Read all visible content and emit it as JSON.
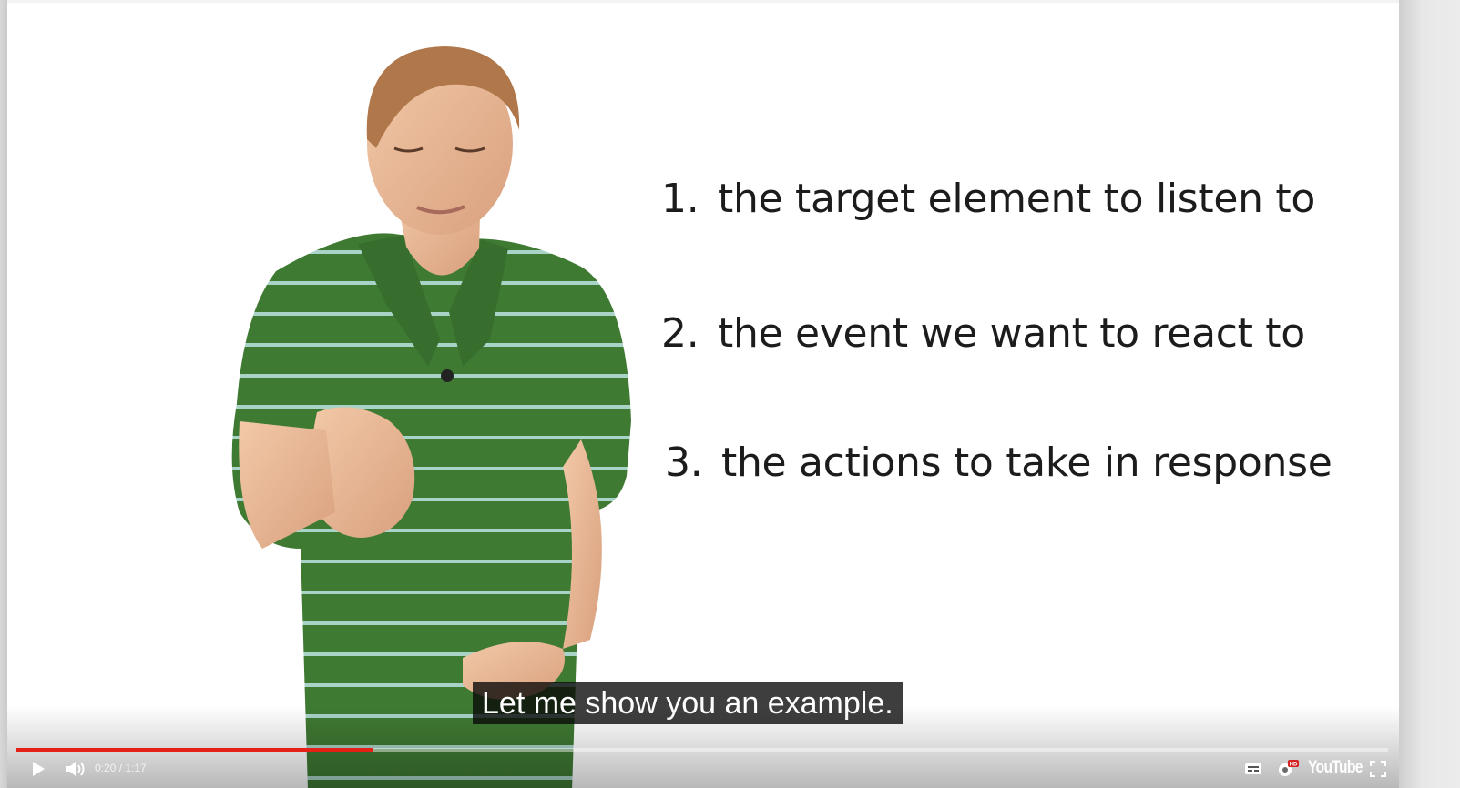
{
  "slide": {
    "items": [
      {
        "number": "1.",
        "text": "the target element to listen to"
      },
      {
        "number": "2.",
        "text": "the event we want to react to"
      },
      {
        "number": "3.",
        "text": "the actions to take in response"
      }
    ]
  },
  "caption": {
    "text": "Let me show you an example."
  },
  "player": {
    "progress_fraction": 0.26,
    "time_display": "0:20 / 1:17",
    "logo_text": "YouTube",
    "hd_badge": "HD",
    "colors": {
      "progress": "#e52117",
      "shirt": "#3f7a33",
      "stripe": "#a9d3c7"
    }
  },
  "icons": {
    "play": "play-icon",
    "volume": "volume-icon",
    "captions": "captions-icon",
    "settings": "settings-gear-icon",
    "fullscreen": "fullscreen-icon"
  }
}
